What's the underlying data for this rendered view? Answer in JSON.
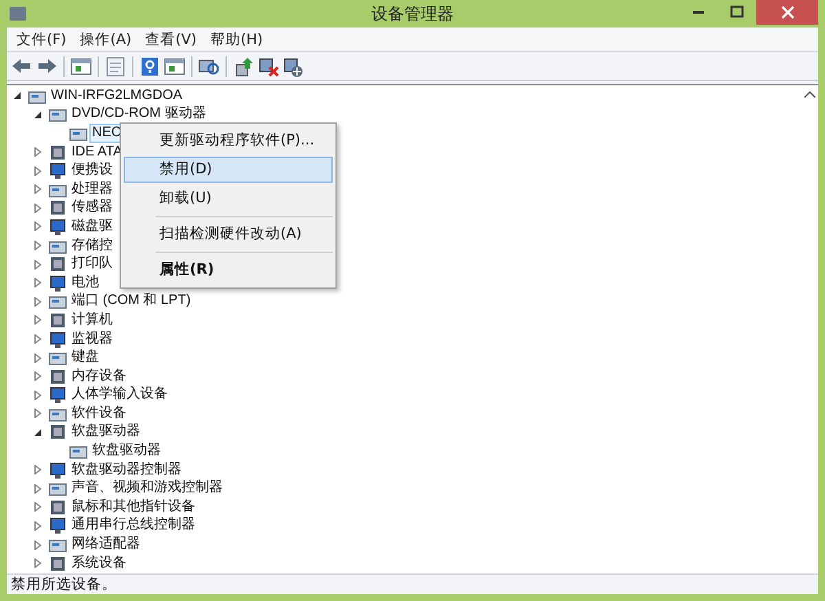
{
  "window": {
    "title": "设备管理器"
  },
  "menu_bar": [
    {
      "label": "文件(F)"
    },
    {
      "label": "操作(A)"
    },
    {
      "label": "查看(V)"
    },
    {
      "label": "帮助(H)"
    }
  ],
  "toolbar": [
    {
      "kind": "back"
    },
    {
      "kind": "forward"
    },
    {
      "kind": "separator"
    },
    {
      "kind": "panel"
    },
    {
      "kind": "separator"
    },
    {
      "kind": "sheet"
    },
    {
      "kind": "separator"
    },
    {
      "kind": "help"
    },
    {
      "kind": "panel"
    },
    {
      "kind": "separator"
    },
    {
      "kind": "scan"
    },
    {
      "kind": "separator"
    },
    {
      "kind": "update"
    },
    {
      "kind": "remove"
    },
    {
      "kind": "install"
    }
  ],
  "tree": [
    {
      "label": "WIN-IRFG2LMGDOA",
      "expanded": true,
      "selected": false,
      "children": [
        {
          "label": "DVD/CD-ROM 驱动器",
          "expanded": true,
          "selected": false,
          "children": [
            {
              "label": "NEC",
              "selected": true
            }
          ]
        },
        {
          "label": "IDE ATA",
          "expanded": false,
          "selected": false
        },
        {
          "label": "便携设",
          "expanded": false,
          "selected": false
        },
        {
          "label": "处理器",
          "expanded": false,
          "selected": false
        },
        {
          "label": "传感器",
          "expanded": false,
          "selected": false
        },
        {
          "label": "磁盘驱",
          "expanded": false,
          "selected": false
        },
        {
          "label": "存储控",
          "expanded": false,
          "selected": false
        },
        {
          "label": "打印队",
          "expanded": false,
          "selected": false
        },
        {
          "label": "电池",
          "expanded": false,
          "selected": false
        },
        {
          "label": "端口 (COM 和 LPT)",
          "expanded": false,
          "selected": false
        },
        {
          "label": "计算机",
          "expanded": false,
          "selected": false
        },
        {
          "label": "监视器",
          "expanded": false,
          "selected": false
        },
        {
          "label": "键盘",
          "expanded": false,
          "selected": false
        },
        {
          "label": "内存设备",
          "expanded": false,
          "selected": false
        },
        {
          "label": "人体学输入设备",
          "expanded": false,
          "selected": false
        },
        {
          "label": "软件设备",
          "expanded": false,
          "selected": false
        },
        {
          "label": "软盘驱动器",
          "expanded": true,
          "selected": false,
          "children": [
            {
              "label": "软盘驱动器",
              "selected": false
            }
          ]
        },
        {
          "label": "软盘驱动器控制器",
          "expanded": false,
          "selected": false
        },
        {
          "label": "声音、视频和游戏控制器",
          "expanded": false,
          "selected": false
        },
        {
          "label": "鼠标和其他指针设备",
          "expanded": false,
          "selected": false
        },
        {
          "label": "通用串行总线控制器",
          "expanded": false,
          "selected": false
        },
        {
          "label": "网络适配器",
          "expanded": false,
          "selected": false
        },
        {
          "label": "系统设备",
          "expanded": false,
          "selected": false
        }
      ]
    }
  ],
  "context_menu": [
    {
      "kind": "item",
      "label": "更新驱动程序软件(P)...",
      "selected": false
    },
    {
      "kind": "item",
      "label": "禁用(D)",
      "selected": true
    },
    {
      "kind": "item",
      "label": "卸载(U)",
      "selected": false
    },
    {
      "kind": "separator"
    },
    {
      "kind": "item",
      "label": "扫描检测硬件改动(A)",
      "selected": false
    },
    {
      "kind": "separator"
    },
    {
      "kind": "default",
      "label": "属性(R)",
      "selected": false
    }
  ],
  "status_bar": {
    "text": "禁用所选设备。"
  }
}
